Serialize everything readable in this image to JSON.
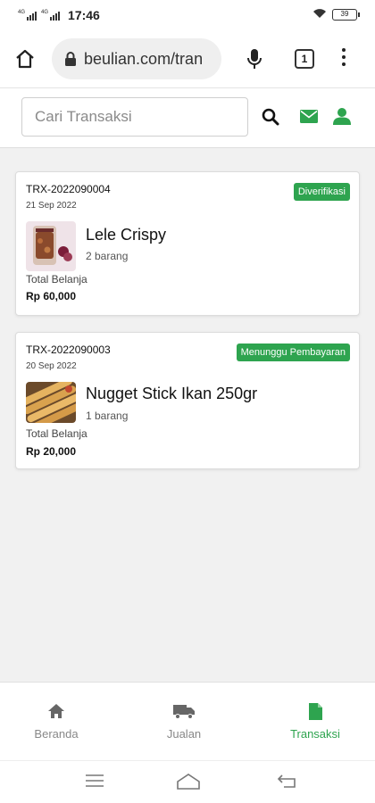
{
  "status_bar": {
    "time": "17:46",
    "signal_label_1": "4G",
    "signal_label_2": "4G",
    "battery": "39"
  },
  "browser": {
    "url": "beulian.com/tran",
    "tab_count": "1"
  },
  "search": {
    "placeholder": "Cari Transaksi"
  },
  "transactions": [
    {
      "id": "TRX-2022090004",
      "date": "21 Sep 2022",
      "status": "Diverifikasi",
      "product": "Lele Crispy",
      "quantity": "2 barang",
      "total_label": "Total Belanja",
      "total": "Rp 60,000"
    },
    {
      "id": "TRX-2022090003",
      "date": "20 Sep 2022",
      "status": "Menunggu Pembayaran",
      "product": "Nugget Stick Ikan 250gr",
      "quantity": "1 barang",
      "total_label": "Total Belanja",
      "total": "Rp 20,000"
    }
  ],
  "bottom_nav": [
    {
      "label": "Beranda",
      "icon": "home-icon",
      "active": false
    },
    {
      "label": "Jualan",
      "icon": "truck-icon",
      "active": false
    },
    {
      "label": "Transaksi",
      "icon": "document-icon",
      "active": true
    }
  ],
  "colors": {
    "accent_green": "#2ea44f",
    "nav_inactive": "#888888",
    "background": "#f1f1f1"
  }
}
